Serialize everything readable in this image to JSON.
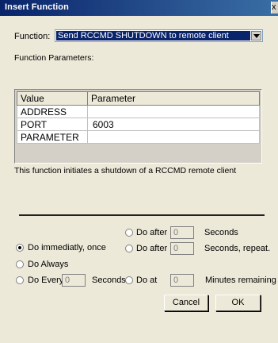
{
  "window": {
    "title": "Insert Function",
    "close_glyph": "x"
  },
  "function": {
    "label": "Function:",
    "selected": "Send RCCMD SHUTDOWN to remote client"
  },
  "params": {
    "label": "Function Parameters:",
    "columns": [
      "Value",
      "Parameter"
    ],
    "rows": [
      {
        "value": "ADDRESS",
        "param": ""
      },
      {
        "value": "PORT",
        "param": "6003"
      },
      {
        "value": "PARAMETER",
        "param": ""
      }
    ]
  },
  "description": "This function initiates a shutdown of a RCCMD remote client",
  "options": {
    "do_immediately": {
      "label": "Do immediatly, once",
      "checked": true
    },
    "do_always": {
      "label": "Do Always",
      "checked": false
    },
    "do_every": {
      "label": "Do Every",
      "value": "0",
      "unit": "Seconds",
      "checked": false
    },
    "do_after_1": {
      "label": "Do after",
      "value": "0",
      "unit": "Seconds",
      "checked": false
    },
    "do_after_2": {
      "label": "Do after",
      "value": "0",
      "unit": "Seconds, repeat.",
      "checked": false
    },
    "do_at": {
      "label": "Do at",
      "value": "0",
      "unit": "Minutes remaining",
      "checked": false
    }
  },
  "buttons": {
    "cancel": "Cancel",
    "ok": "OK"
  }
}
